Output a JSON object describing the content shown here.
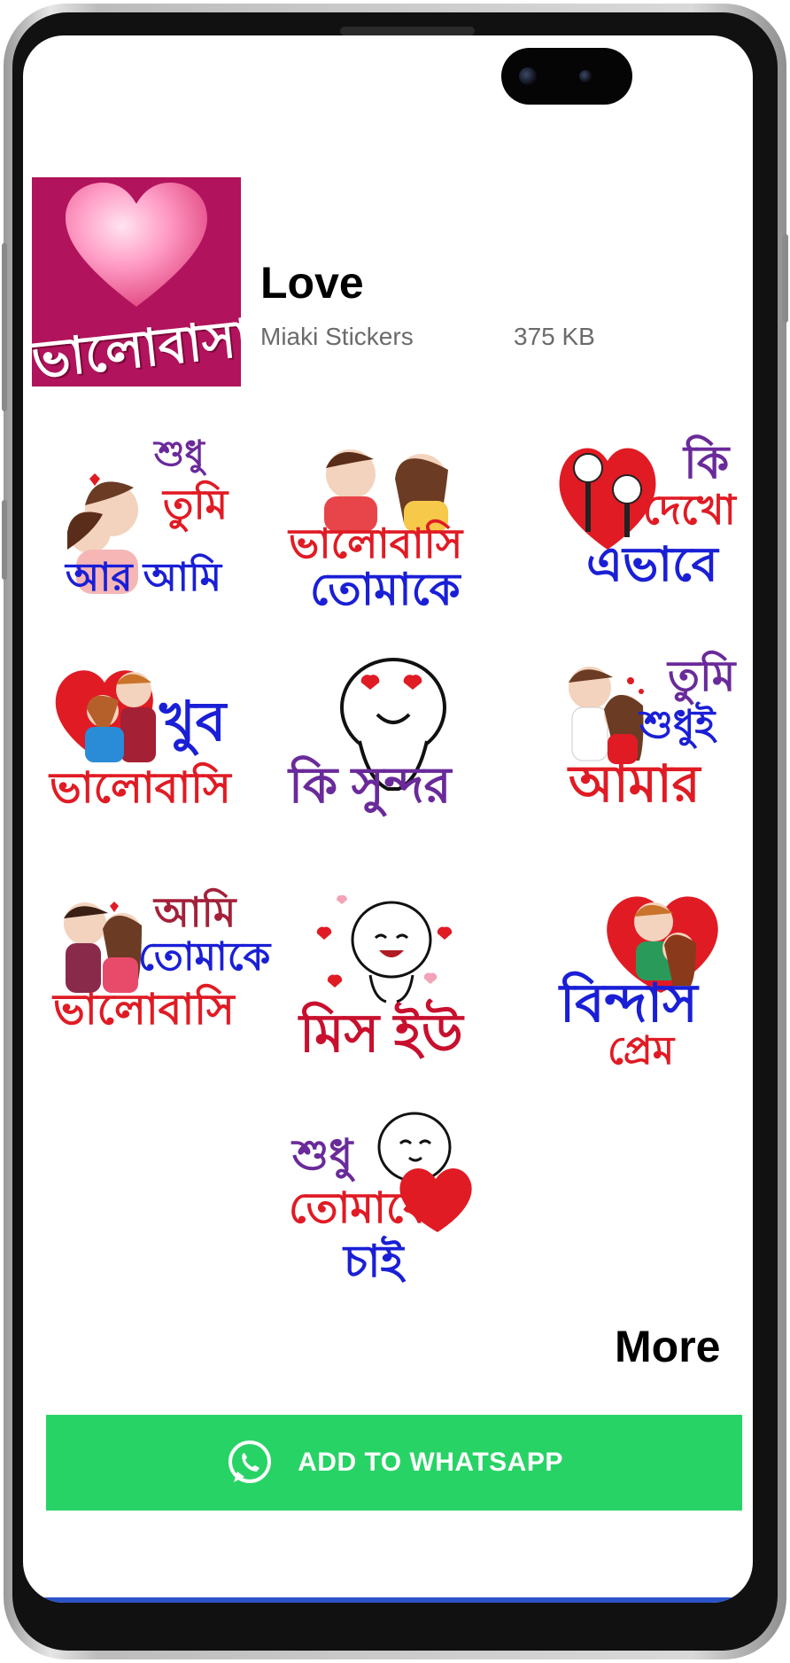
{
  "pack": {
    "tray_text": "ভালোবাসা",
    "title": "Love",
    "publisher": "Miaki Stickers",
    "size": "375 KB"
  },
  "stickers": [
    {
      "lines": [
        "শুধু",
        "তুমি",
        "আর আমি"
      ]
    },
    {
      "lines": [
        "ভালোবাসি",
        "তোমাকে"
      ]
    },
    {
      "lines": [
        "কি",
        "দেখো",
        "এভাবে"
      ]
    },
    {
      "lines": [
        "খুব",
        "ভালোবাসি"
      ]
    },
    {
      "lines": [
        "কি সুন্দর"
      ]
    },
    {
      "lines": [
        "তুমি",
        "শুধুই",
        "আমার"
      ]
    },
    {
      "lines": [
        "আমি",
        "তোমাকে",
        "ভালোবাসি"
      ]
    },
    {
      "lines": [
        "মিস ইউ"
      ]
    },
    {
      "lines": [
        "বিন্দাস",
        "প্রেম"
      ]
    },
    {
      "lines": [
        "শুধু",
        "তোমাকে",
        "চাই"
      ]
    }
  ],
  "more_label": "More",
  "add_button_label": "ADD TO WHATSAPP",
  "colors": {
    "whatsapp_green": "#28d366",
    "tray_bg": "#b1135c",
    "sticker_red": "#e01b24",
    "sticker_blue": "#1a1fd6",
    "sticker_purple": "#6a2a9a"
  },
  "icons": [
    "whatsapp-icon",
    "heart-icon"
  ]
}
